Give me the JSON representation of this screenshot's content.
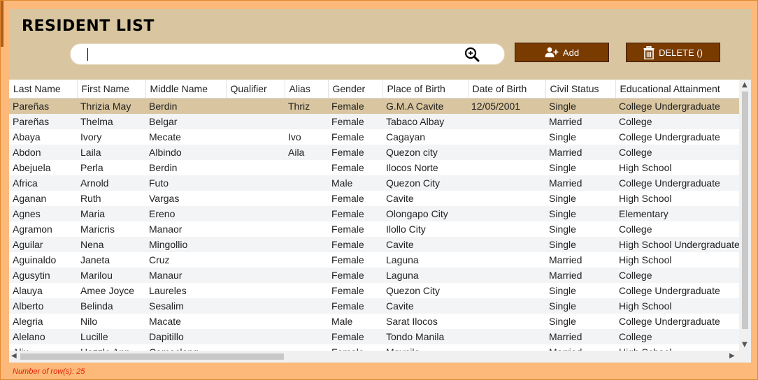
{
  "header": {
    "title": "RESIDENT LIST"
  },
  "search": {
    "value": "",
    "placeholder": ""
  },
  "buttons": {
    "add_label": "Add",
    "delete_label": "DELETE ()"
  },
  "table": {
    "columns": [
      "Last Name",
      "First Name",
      "Middle Name",
      "Qualifier",
      "Alias",
      "Gender",
      "Place of Birth",
      "Date of Birth",
      "Civil Status",
      "Educational Attainment"
    ],
    "rows": [
      [
        "Pareñas",
        "Thrizia May",
        "Berdin",
        "",
        "Thriz",
        "Female",
        "G.M.A Cavite",
        "12/05/2001",
        "Single",
        "College Undergraduate"
      ],
      [
        "Pareñas",
        "Thelma",
        "Belgar",
        "",
        "",
        "Female",
        "Tabaco Albay",
        "",
        "Married",
        "College"
      ],
      [
        "Abaya",
        "Ivory",
        "Mecate",
        "",
        "Ivo",
        "Female",
        "Cagayan",
        "",
        "Single",
        "College Undergraduate"
      ],
      [
        "Abdon",
        "Laila",
        "Albindo",
        "",
        "Aila",
        "Female",
        "Quezon city",
        "",
        "Married",
        "College"
      ],
      [
        "Abejuela",
        "Perla",
        "Berdin",
        "",
        "",
        "Female",
        "Ilocos Norte",
        "",
        "Single",
        "High School"
      ],
      [
        "Africa",
        "Arnold",
        "Futo",
        "",
        "",
        "Male",
        "Quezon City",
        "",
        "Married",
        "College Undergraduate"
      ],
      [
        "Aganan",
        "Ruth",
        "Vargas",
        "",
        "",
        "Female",
        "Cavite",
        "",
        "Single",
        "High School"
      ],
      [
        "Agnes",
        "Maria",
        "Ereno",
        "",
        "",
        "Female",
        "Olongapo City",
        "",
        "Single",
        "Elementary"
      ],
      [
        "Agramon",
        "Maricris",
        "Manaor",
        "",
        "",
        "Female",
        "Ilollo City",
        "",
        "Single",
        "College"
      ],
      [
        "Aguilar",
        "Nena",
        "Mingollio",
        "",
        "",
        "Female",
        "Cavite",
        "",
        "Single",
        "High School Undergraduate"
      ],
      [
        "Aguinaldo",
        "Janeta",
        "Cruz",
        "",
        "",
        "Female",
        "Laguna",
        "",
        "Married",
        "High School"
      ],
      [
        "Agusytin",
        "Marilou",
        "Manaur",
        "",
        "",
        "Female",
        "Laguna",
        "",
        "Married",
        "College"
      ],
      [
        "Alauya",
        "Amee Joyce",
        "Laureles",
        "",
        "",
        "Female",
        "Quezon City",
        "",
        "Single",
        "College Undergraduate"
      ],
      [
        "Alberto",
        "Belinda",
        "Sesalim",
        "",
        "",
        "Female",
        "Cavite",
        "",
        "Single",
        "High School"
      ],
      [
        "Alegria",
        "Nilo",
        "Macate",
        "",
        "",
        "Male",
        "Sarat Ilocos",
        "",
        "Single",
        "College Undergraduate"
      ],
      [
        "Alelano",
        "Lucille",
        "Dapitillo",
        "",
        "",
        "Female",
        "Tondo Manila",
        "",
        "Married",
        "College"
      ],
      [
        "Alix",
        "Hazzle Ann",
        "Camaclang",
        "",
        "",
        "Female",
        "Maynila",
        "",
        "Married",
        "High School"
      ]
    ],
    "selected_row": 0
  },
  "footer": {
    "row_count": "Number of row(s): 25"
  },
  "colors": {
    "panel": "#d9c6a0",
    "frame": "#fdb97a",
    "button": "#7a3b00",
    "row_count_text": "#e01e00"
  },
  "icons": {
    "search": "search-zoom-icon",
    "add": "add-user-icon",
    "delete": "trash-icon"
  }
}
